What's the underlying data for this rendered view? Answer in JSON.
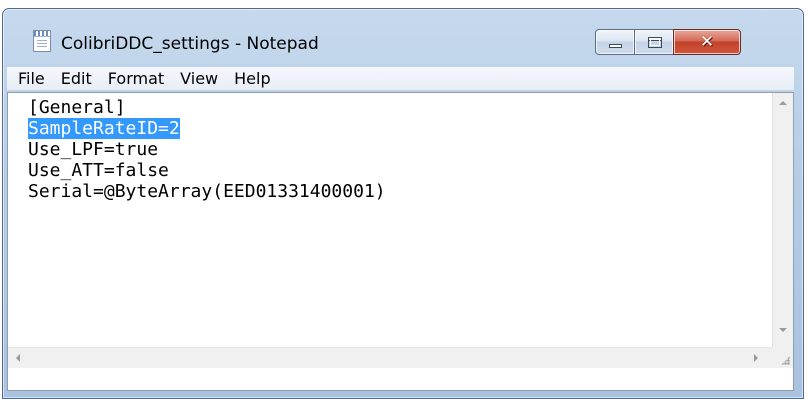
{
  "window": {
    "title": "ColibriDDC_settings - Notepad",
    "app_icon": "notepad-icon",
    "controls": {
      "minimize_icon": "minimize-icon",
      "maximize_icon": "maximize-icon",
      "close_glyph": "✕"
    }
  },
  "menubar": {
    "items": [
      "File",
      "Edit",
      "Format",
      "View",
      "Help"
    ]
  },
  "editor": {
    "lines": [
      "[General]",
      "SampleRateID=2",
      "Use_LPF=true",
      "Use_ATT=false",
      "Serial=@ByteArray(EED01331400001)"
    ],
    "selected_line_index": 1
  },
  "colors": {
    "selection": "#3399ff",
    "titlebar": "#b7cde6",
    "close_button": "#c2412a"
  }
}
